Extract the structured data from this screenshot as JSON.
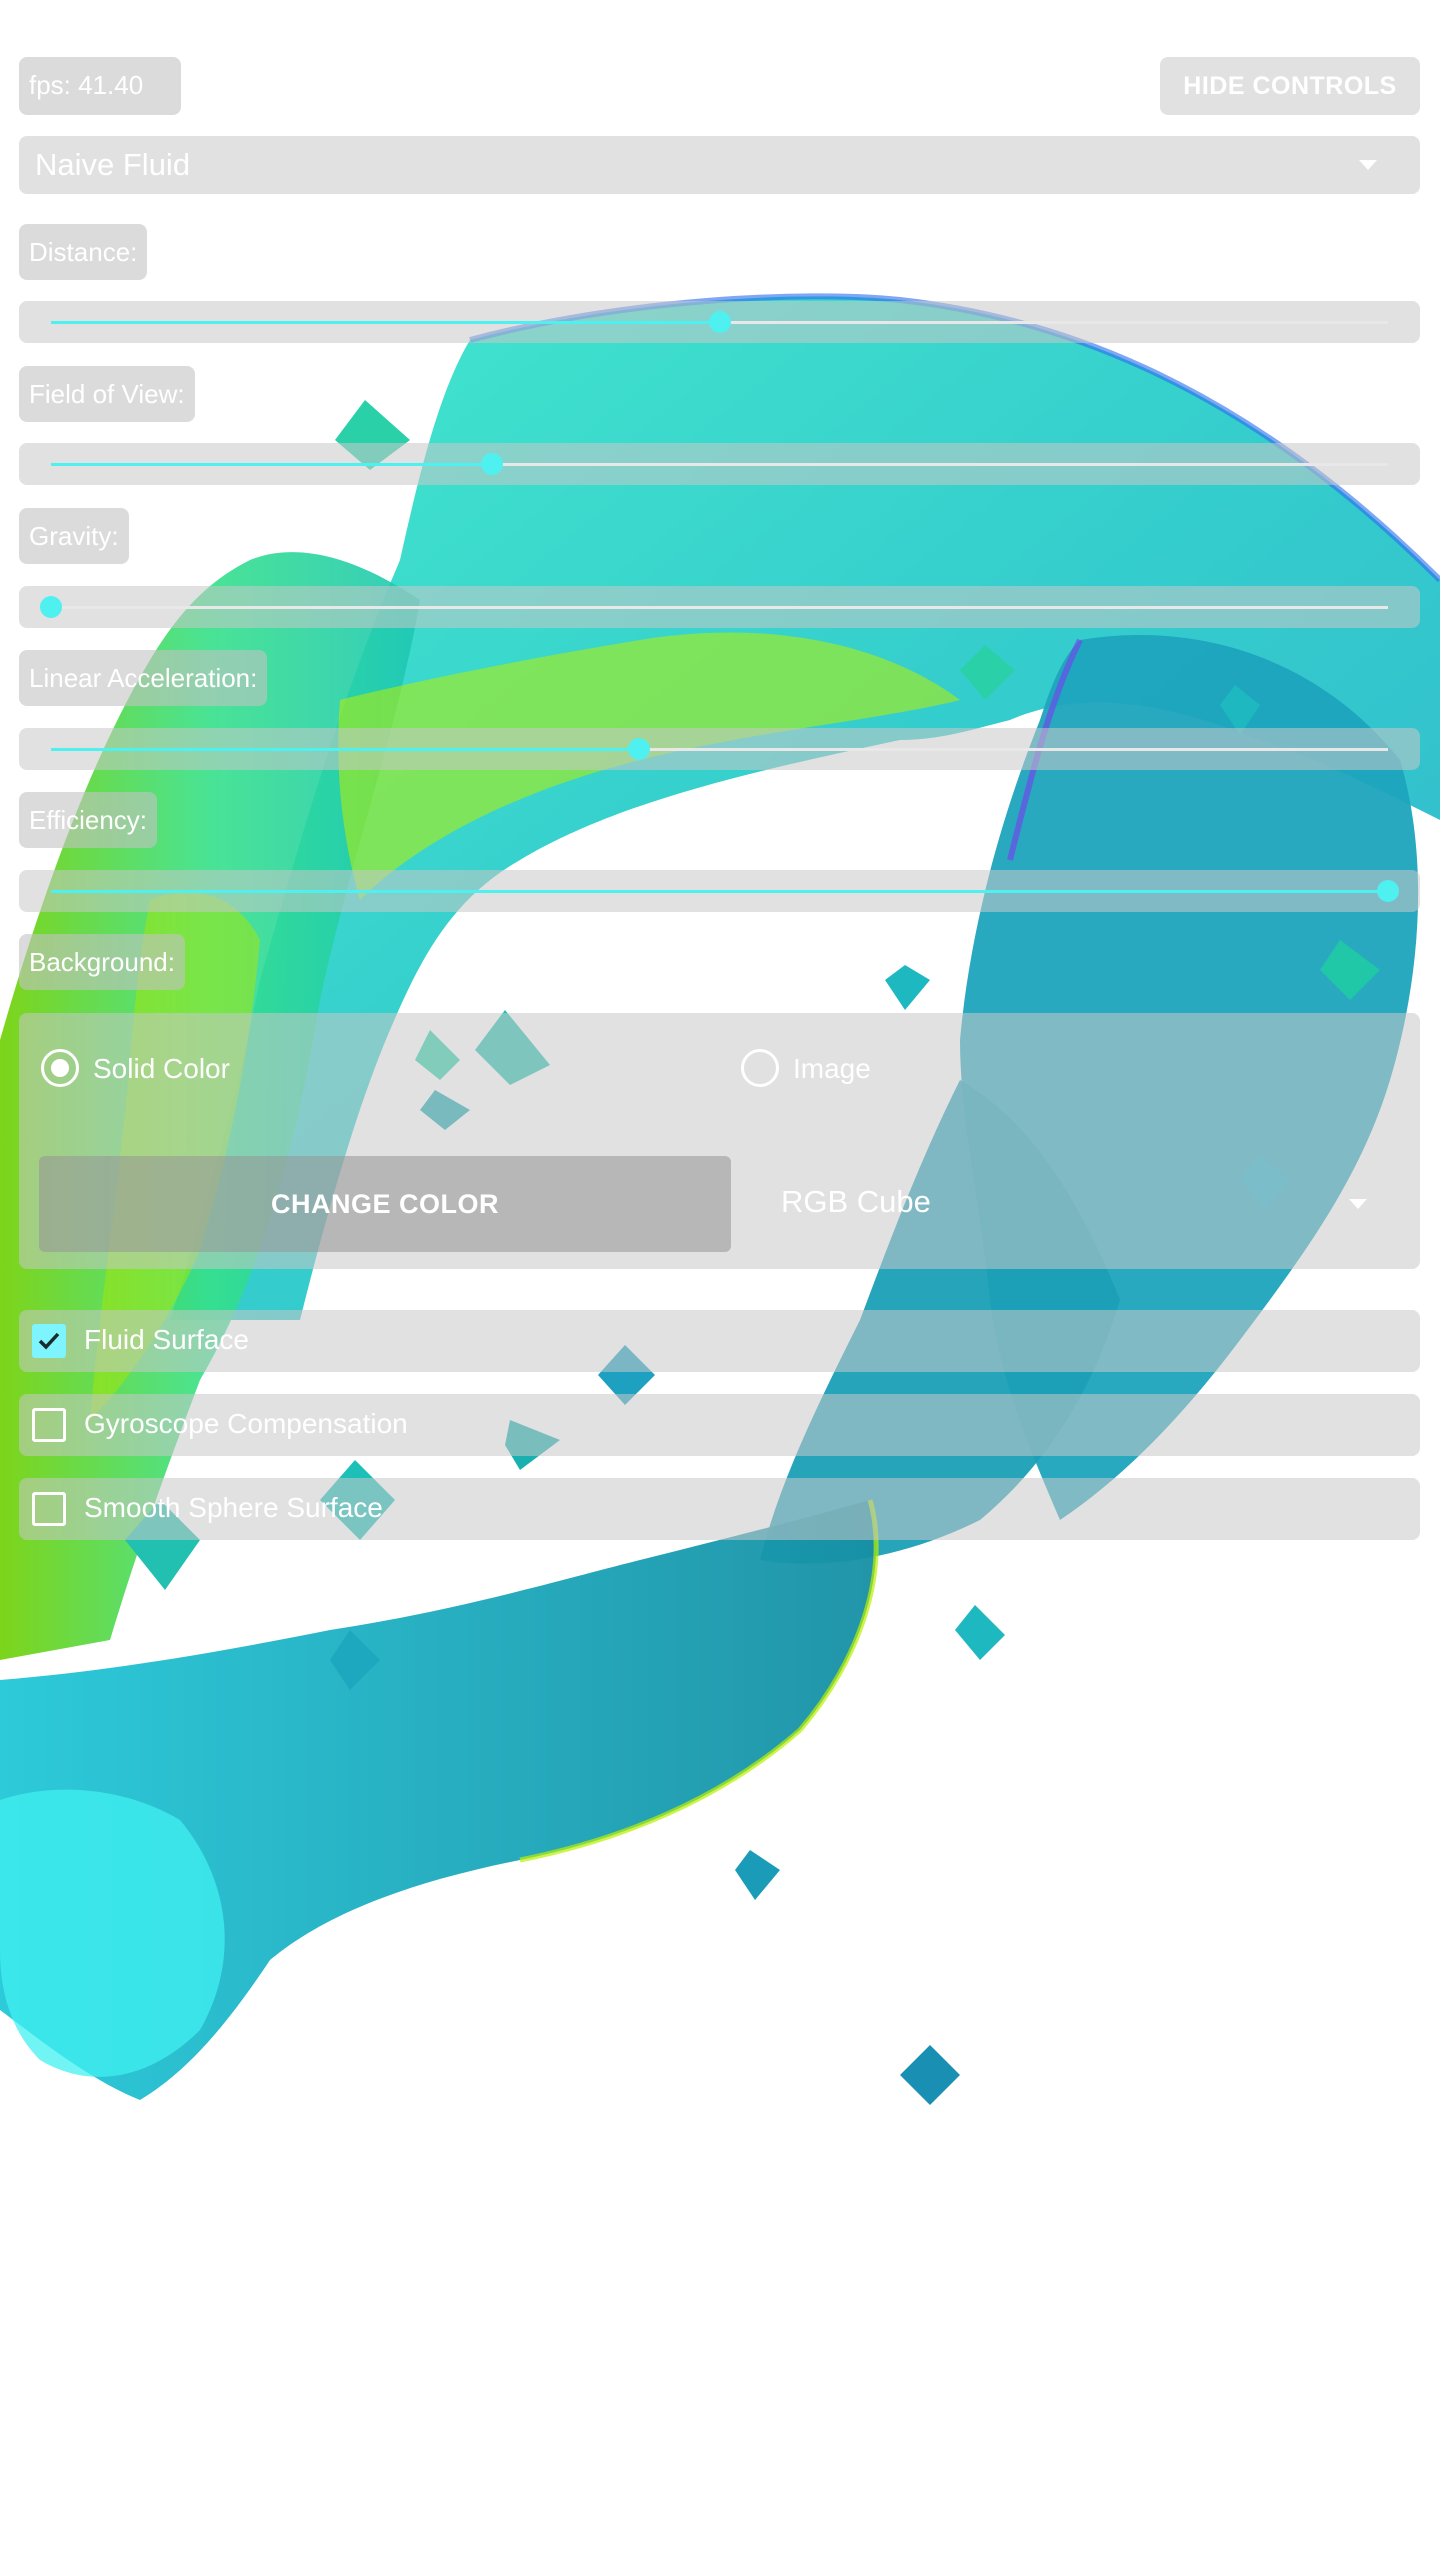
{
  "header": {
    "fps_label": "fps: 41.40",
    "hide_controls_label": "HIDE CONTROLS"
  },
  "simulation_select": {
    "selected": "Naive Fluid"
  },
  "sliders": [
    {
      "label": "Distance:",
      "value": 0.5
    },
    {
      "label": "Field of View:",
      "value": 0.33
    },
    {
      "label": "Gravity:",
      "value": 0.0
    },
    {
      "label": "Linear Acceleration:",
      "value": 0.44
    },
    {
      "label": "Efficiency:",
      "value": 1.0
    }
  ],
  "background": {
    "label": "Background:",
    "options": [
      {
        "label": "Solid Color",
        "selected": true
      },
      {
        "label": "Image",
        "selected": false
      }
    ],
    "change_color_label": "CHANGE COLOR",
    "color_scheme_selected": "RGB Cube"
  },
  "checkboxes": [
    {
      "label": "Fluid Surface",
      "checked": true
    },
    {
      "label": "Gyroscope Compensation",
      "checked": false
    },
    {
      "label": "Smooth Sphere Surface",
      "checked": false
    }
  ],
  "colors": {
    "accent": "#4ff0f0",
    "fluid_teal": "#1aa3b0",
    "fluid_green": "#3cf09a",
    "fluid_yellow": "#b8f000",
    "fluid_blue": "#2a6cf0"
  }
}
